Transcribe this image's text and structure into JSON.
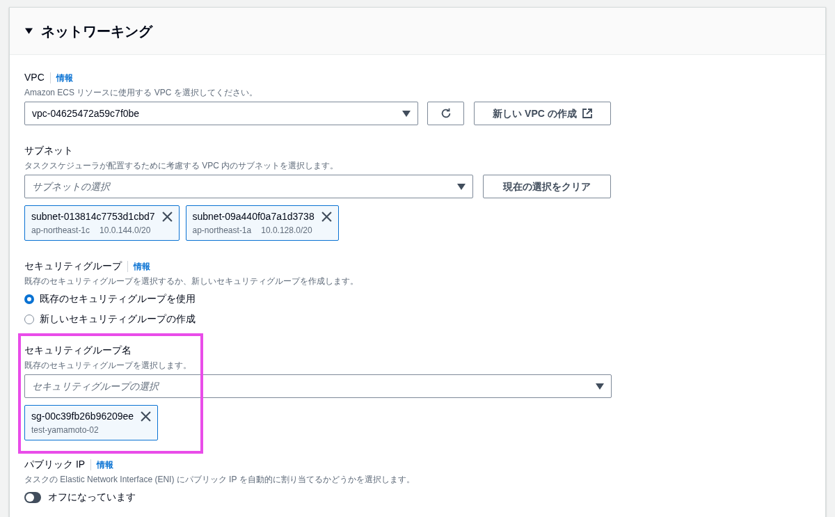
{
  "section": {
    "title": "ネットワーキング",
    "expanded": true
  },
  "vpc": {
    "label": "VPC",
    "info": "情報",
    "description": "Amazon ECS リソースに使用する VPC を選択してください。",
    "value": "vpc-04625472a59c7f0be",
    "create_button": "新しい VPC の作成"
  },
  "subnets": {
    "label": "サブネット",
    "description": "タスクスケジューラが配置するために考慮する VPC 内のサブネットを選択します。",
    "placeholder": "サブネットの選択",
    "clear_button": "現在の選択をクリア",
    "tokens": [
      {
        "name": "subnet-013814c7753d1cbd7",
        "zone": "ap-northeast-1c",
        "cidr": "10.0.144.0/20"
      },
      {
        "name": "subnet-09a440f0a7a1d3738",
        "zone": "ap-northeast-1a",
        "cidr": "10.0.128.0/20"
      }
    ]
  },
  "security_group": {
    "label": "セキュリティグループ",
    "info": "情報",
    "description": "既存のセキュリティグループを選択するか、新しいセキュリティグループを作成します。",
    "options": [
      {
        "label": "既存のセキュリティグループを使用",
        "selected": true
      },
      {
        "label": "新しいセキュリティグループの作成",
        "selected": false
      }
    ]
  },
  "security_group_name": {
    "label": "セキュリティグループ名",
    "description": "既存のセキュリティグループを選択します。",
    "placeholder": "セキュリティグループの選択",
    "highlighted": true,
    "tokens": [
      {
        "name": "sg-00c39fb26b96209ee",
        "detail": "test-yamamoto-02"
      }
    ]
  },
  "public_ip": {
    "label": "パブリック IP",
    "info": "情報",
    "description": "タスクの Elastic Network Interface (ENI) にパブリック IP を自動的に割り当てるかどうかを選択します。",
    "toggle_label": "オフになっています",
    "on": false
  }
}
